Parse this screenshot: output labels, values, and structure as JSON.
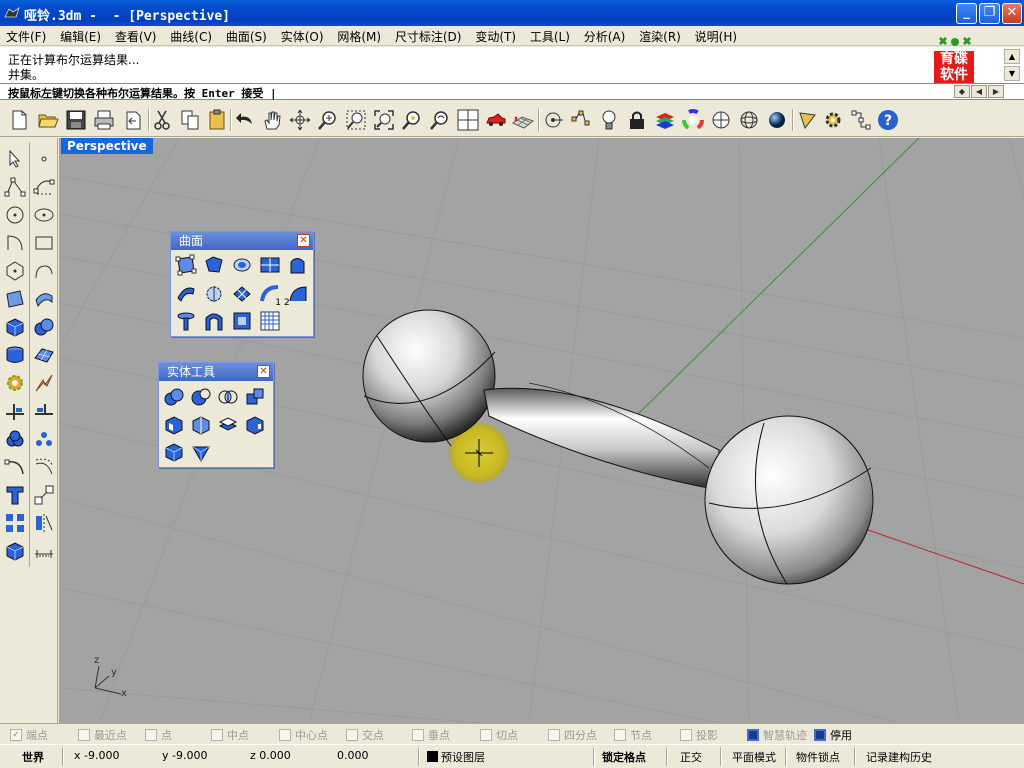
{
  "window": {
    "title": "哑铃.3dm -  - [Perspective]",
    "buttons": {
      "minimize": "_",
      "maximize": "❐",
      "close": "✕"
    }
  },
  "menu": [
    "文件(F)",
    "编辑(E)",
    "查看(V)",
    "曲线(C)",
    "曲面(S)",
    "实体(O)",
    "网格(M)",
    "尺寸标注(D)",
    "变动(T)",
    "工具(L)",
    "分析(A)",
    "渲染(R)",
    "说明(H)"
  ],
  "command_history": [
    "正在计算布尔运算结果...",
    "并集。"
  ],
  "command_prompt": "按鼠标左键切换各种布尔运算结果。按 Enter 接受 |",
  "logo": {
    "line1": "育碟",
    "line2": "软件",
    "icon": "dice-logo-icon"
  },
  "toolbar": {
    "icons": [
      "new-file-icon",
      "open-file-icon",
      "save-icon",
      "print-icon",
      "import-icon",
      "cut-icon",
      "copy-icon",
      "paste-icon",
      "undo-icon",
      "pan-hand-icon",
      "rotate-view-icon",
      "zoom-icon",
      "zoom-window-icon",
      "zoom-extents-icon",
      "zoom-selected-icon",
      "undo-view-icon",
      "four-viewports-icon",
      "car-icon",
      "grid-plane-icon",
      "cplane-icon",
      "snap-points-icon",
      "light-icon",
      "lock-icon",
      "layer-icon",
      "color-wheel-icon",
      "shade-icon",
      "wireframe-sphere-icon",
      "render-sphere-icon",
      "nurbs-curve-icon",
      "gear-icon",
      "grips-icon",
      "help-icon"
    ]
  },
  "left_toolbar": {
    "icons": [
      "select-arrow-icon",
      "point-icon",
      "polyline-icon",
      "curve-icon",
      "circle-icon",
      "ellipse-icon",
      "arc-icon",
      "rectangle-icon",
      "polygon-icon",
      "freeform-icon",
      "surface-corner-icon",
      "surface-loft-icon",
      "box-icon",
      "sphere-group-icon",
      "cylinder-icon",
      "mesh-plane-icon",
      "explode-gear-icon",
      "split-icon",
      "trim-icon",
      "join-icon",
      "boolean-union-icon",
      "points-group-icon",
      "fillet-icon",
      "offset-curve-icon",
      "text-icon",
      "scale-icon",
      "array-icon",
      "mirror-icon",
      "solid-box-icon",
      "dimension-icon"
    ]
  },
  "viewport": {
    "label": "Perspective",
    "axes": {
      "z": "z",
      "y": "y",
      "x": "x"
    }
  },
  "panels": {
    "surface": {
      "title": "曲面",
      "icons": [
        "surface-from-points-icon",
        "patch-surface-icon",
        "sphere-surface-icon",
        "grid-surface-icon",
        "extrude-surface-icon",
        "sweep-rail-icon",
        "revolve-icon",
        "network-surface-icon",
        "sweep1-icon",
        "sweep2-icon",
        "loft-icon",
        "rail-revolve-icon",
        "planar-surface-icon",
        "point-grid-icon"
      ],
      "sweep_labels": {
        "one": "1",
        "two": "2"
      }
    },
    "solid": {
      "title": "实体工具",
      "icons": [
        "boolean-union-icon",
        "boolean-difference-icon",
        "boolean-intersection-icon",
        "boolean-split-icon",
        "cap-planar-holes-icon",
        "extract-surface-icon",
        "merge-faces-icon",
        "shell-icon",
        "solid-box-icon",
        "solid-wedge-icon"
      ]
    }
  },
  "osnaps": [
    {
      "label": "端点",
      "checked": true
    },
    {
      "label": "最近点",
      "checked": false
    },
    {
      "label": "点",
      "checked": false
    },
    {
      "label": "中点",
      "checked": false
    },
    {
      "label": "中心点",
      "checked": false
    },
    {
      "label": "交点",
      "checked": false
    },
    {
      "label": "垂点",
      "checked": false
    },
    {
      "label": "切点",
      "checked": false
    },
    {
      "label": "四分点",
      "checked": false
    },
    {
      "label": "节点",
      "checked": false
    },
    {
      "label": "投影",
      "checked": false
    },
    {
      "label": "智慧轨迹",
      "checked": true,
      "greyed": true
    },
    {
      "label": "停用",
      "checked": true
    }
  ],
  "status": {
    "cplane": "世界",
    "x": "x -9.000",
    "y": "y -9.000",
    "z": "z 0.000",
    "distance": "0.000",
    "layer": "预设图层",
    "snap": "锁定格点",
    "ortho": "正交",
    "planar": "平面模式",
    "osnap": "物件锁点",
    "history": "记录建构历史"
  }
}
